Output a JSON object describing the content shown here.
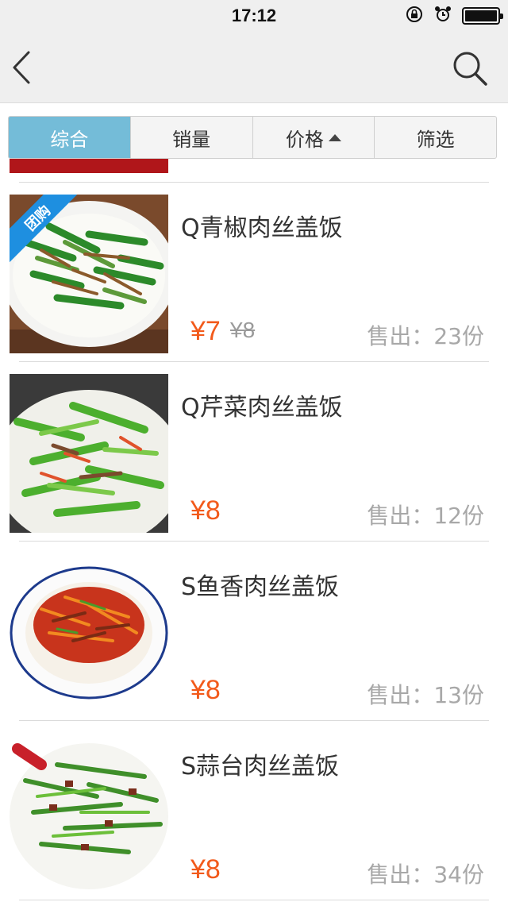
{
  "status_bar": {
    "time": "17:12",
    "icons": [
      "rotation-lock-icon",
      "alarm-icon",
      "battery-icon"
    ],
    "battery_level": 1.0
  },
  "nav": {
    "back_icon": "chevron-left-icon",
    "search_icon": "search-icon"
  },
  "tabs": [
    {
      "label": "综合",
      "active": true
    },
    {
      "label": "销量",
      "active": false
    },
    {
      "label": "价格",
      "active": false,
      "icon": "sort-up-icon"
    },
    {
      "label": "筛选",
      "active": false
    }
  ],
  "colors": {
    "accent_tab": "#74bcd8",
    "price": "#f25a1b",
    "badge": "#1e8fe0"
  },
  "items": [
    {
      "title": "Q青椒肉丝盖饭",
      "price": "¥7",
      "old_price": "¥8",
      "sold": "售出：23份",
      "badge": "团购",
      "image": "green-pepper-shredded-pork-rice-photo"
    },
    {
      "title": "Q芹菜肉丝盖饭",
      "price": "¥8",
      "sold": "售出：12份",
      "image": "celery-shredded-pork-rice-photo"
    },
    {
      "title": "S鱼香肉丝盖饭",
      "price": "¥8",
      "sold": "售出：13份",
      "image": "fish-flavored-shredded-pork-rice-photo"
    },
    {
      "title": "S蒜台肉丝盖饭",
      "price": "¥8",
      "sold": "售出：34份",
      "image": "garlic-sprout-shredded-pork-rice-photo"
    }
  ]
}
